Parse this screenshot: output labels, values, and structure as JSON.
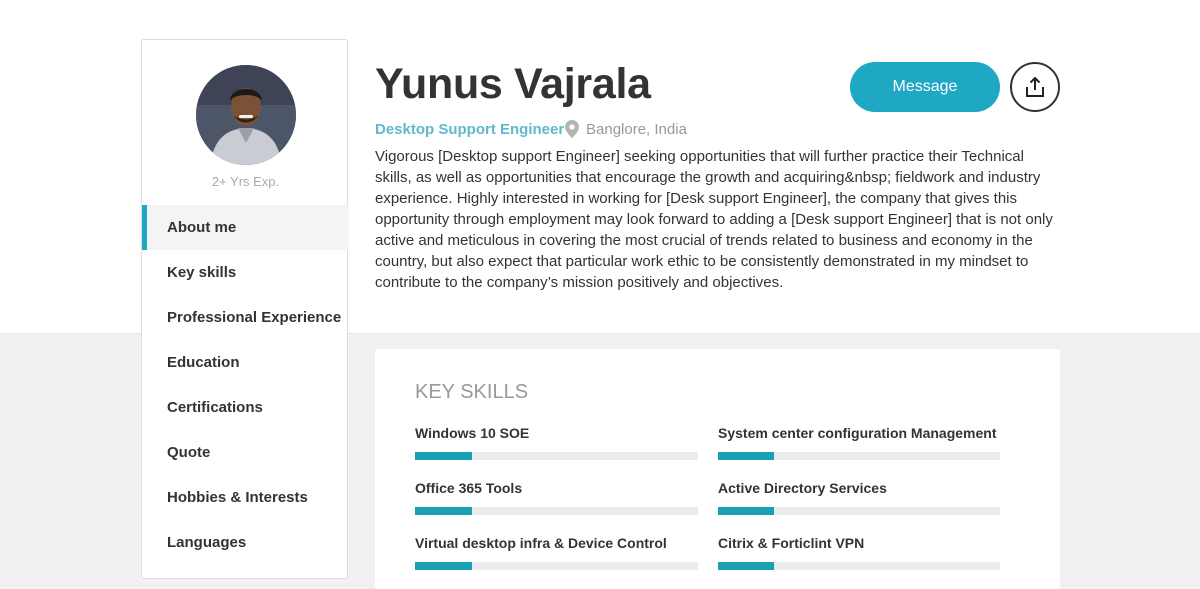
{
  "profile": {
    "name": "Yunus Vajrala",
    "title": "Desktop Support Engineer",
    "location": "Banglore, India",
    "experience": "2+ Yrs Exp.",
    "bio": "Vigorous [Desktop support Engineer] seeking opportunities that will further practice their Technical skills, as well as opportunities that encourage the growth and acquiring&nbsp; fieldwork and industry experience. Highly interested in working for [Desk support Engineer], the company that gives this opportunity through employment may look forward to adding a [Desk support Engineer] that is not only active and meticulous in covering the most crucial of trends related to business and economy in the country, but also expect that particular work ethic to be consistently demonstrated in my mindset to contribute to the company’s mission positively and objectives."
  },
  "actions": {
    "message_label": "Message",
    "share_icon": "share-icon"
  },
  "sidebar": {
    "items": [
      {
        "label": "About me",
        "active": true
      },
      {
        "label": "Key skills"
      },
      {
        "label": "Professional Experience"
      },
      {
        "label": "Education"
      },
      {
        "label": "Certifications"
      },
      {
        "label": "Quote"
      },
      {
        "label": "Hobbies & Interests"
      },
      {
        "label": "Languages"
      }
    ]
  },
  "skills": {
    "title": "KEY SKILLS",
    "items": [
      {
        "name": "Windows 10 SOE",
        "level": 0.2
      },
      {
        "name": "System center configuration Management",
        "level": 0.2
      },
      {
        "name": "Office 365 Tools",
        "level": 0.2
      },
      {
        "name": "Active Directory Services",
        "level": 0.2
      },
      {
        "name": "Virtual desktop infra & Device Control",
        "level": 0.2
      },
      {
        "name": "Citrix & Forticlint VPN",
        "level": 0.2
      }
    ]
  },
  "colors": {
    "accent": "#1fa8c4",
    "role_text": "#5fb8cc",
    "skill_fill": "#1b9fb3"
  }
}
